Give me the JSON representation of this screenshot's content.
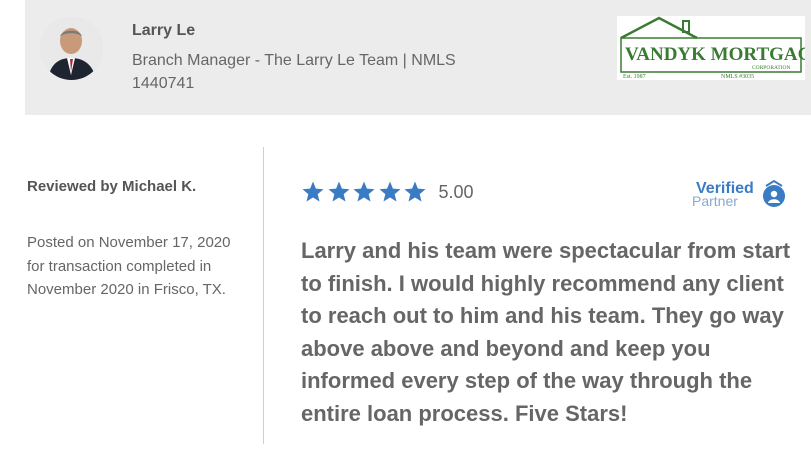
{
  "agent": {
    "name": "Larry Le",
    "title": "Branch Manager - The Larry Le Team | NMLS 1440741"
  },
  "company_logo": {
    "name_line": "VANDYK MORTGAGE",
    "sub_line": "CORPORATION",
    "est": "Est. 1987",
    "nmls": "NMLS #3035",
    "color": "#3a7b33"
  },
  "review": {
    "reviewer": "Reviewed by Michael K.",
    "posted": "Posted on November 17, 2020 for transaction completed in November 2020 in Frisco, TX.",
    "rating_value": "5.00",
    "stars": 5,
    "star_color": "#3a7cc3",
    "text": "Larry and his team were spectacular from start to finish. I would highly recommend any client to reach out to him and his team. They go way above above and beyond and keep you informed every step of the way through the entire loan process. Five Stars!"
  },
  "badge": {
    "line1": "Verified",
    "line2": "Partner",
    "color": "#3a7cc3"
  }
}
